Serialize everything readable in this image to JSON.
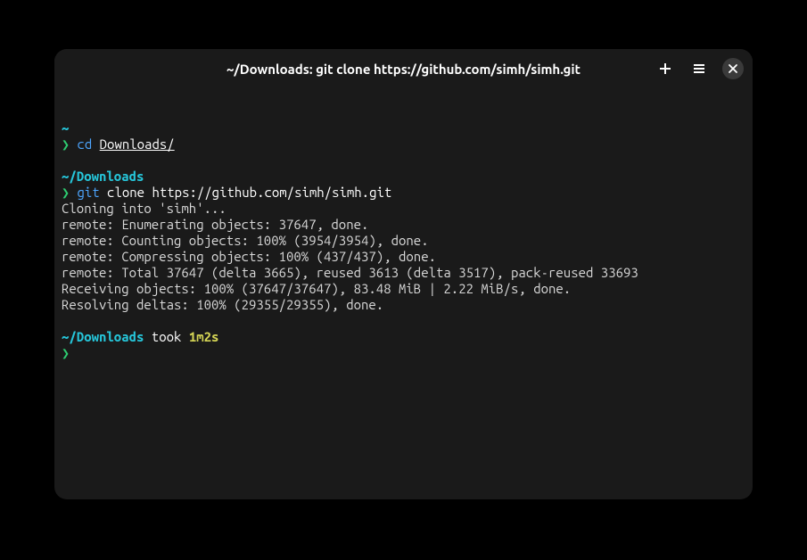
{
  "titlebar": {
    "title": "~/Downloads: git clone https://github.com/simh/simh.git"
  },
  "terminal": {
    "block1": {
      "path": "~",
      "prompt": "❯",
      "cmd": "cd",
      "arg": "Downloads/"
    },
    "block2": {
      "path": "~/Downloads",
      "prompt": "❯",
      "cmd": "git",
      "sub": "clone",
      "url": "https://github.com/simh/simh.git"
    },
    "output": {
      "l1": "Cloning into 'simh'...",
      "l2": "remote: Enumerating objects: 37647, done.",
      "l3": "remote: Counting objects: 100% (3954/3954), done.",
      "l4": "remote: Compressing objects: 100% (437/437), done.",
      "l5": "remote: Total 37647 (delta 3665), reused 3613 (delta 3517), pack-reused 33693",
      "l6": "Receiving objects: 100% (37647/37647), 83.48 MiB | 2.22 MiB/s, done.",
      "l7": "Resolving deltas: 100% (29355/29355), done."
    },
    "block3": {
      "path": "~/Downloads",
      "took_label": " took ",
      "duration": "1m2s",
      "prompt": "❯"
    }
  }
}
